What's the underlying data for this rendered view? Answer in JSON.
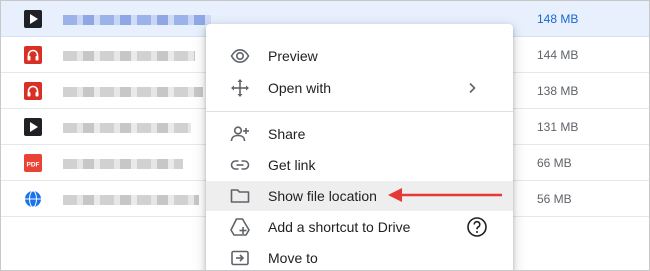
{
  "files": [
    {
      "size": "148 MB",
      "icon": "video-icon",
      "selected": true
    },
    {
      "size": "144 MB",
      "icon": "audio-icon"
    },
    {
      "size": "138 MB",
      "icon": "audio-icon"
    },
    {
      "size": "131 MB",
      "icon": "video-icon"
    },
    {
      "size": "66 MB",
      "icon": "pdf-icon",
      "icon_text": "PDF"
    },
    {
      "size": "56 MB",
      "icon": "globe-icon"
    }
  ],
  "menu": {
    "preview": "Preview",
    "open_with": "Open with",
    "share": "Share",
    "get_link": "Get link",
    "show_file_location": "Show file location",
    "add_shortcut": "Add a shortcut to Drive",
    "move_to": "Move to"
  },
  "colors": {
    "selected_row": "#e8f0fe",
    "accent_blue": "#1a73e8",
    "annotation_arrow": "#e53935",
    "icon_red": "#d93025"
  }
}
